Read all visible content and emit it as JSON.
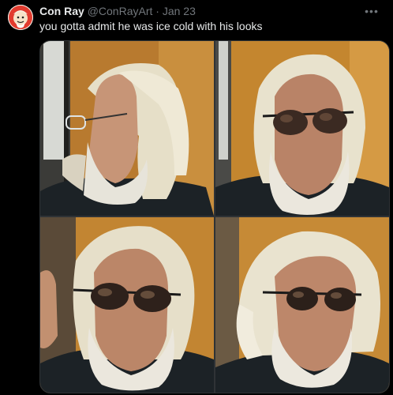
{
  "tweet": {
    "author_name": "Con Ray",
    "author_handle": "@ConRayArt",
    "separator": "·",
    "date": "Jan 23",
    "more_icon": "more-horizontal-icon",
    "text": "you gotta admit he was ice cold with his looks"
  },
  "media": {
    "photos": [
      {
        "pose": "profile-left",
        "glasses": "clear"
      },
      {
        "pose": "front",
        "glasses": "sunglasses"
      },
      {
        "pose": "front-tilted",
        "glasses": "sunglasses"
      },
      {
        "pose": "three-quarter-right",
        "glasses": "sunglasses"
      }
    ]
  },
  "colors": {
    "background": "#000000",
    "text_primary": "#e7e9ea",
    "text_secondary": "#71767b",
    "border": "#2f3336",
    "wall": "#c98a35",
    "hair": "#e8e1cc",
    "shirt": "#1c2226"
  }
}
